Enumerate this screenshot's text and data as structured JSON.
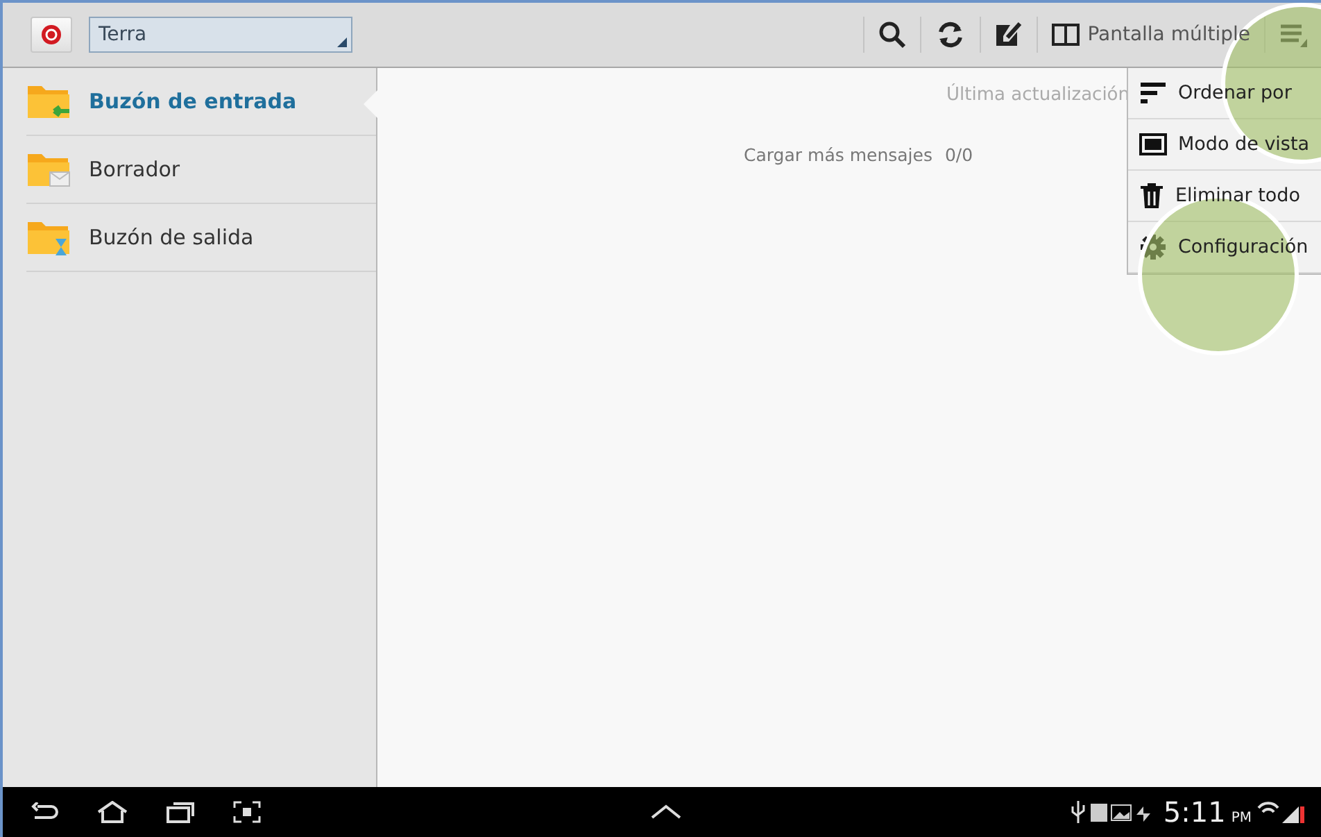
{
  "action_bar": {
    "account": "Terra",
    "actions": [
      {
        "kind": "search"
      },
      {
        "kind": "refresh"
      },
      {
        "kind": "compose"
      },
      {
        "kind": "split",
        "label": "Pantalla múltiple"
      },
      {
        "kind": "menu"
      }
    ]
  },
  "folders": [
    {
      "label": "Buzón de entrada",
      "kind": "inbox",
      "selected": true
    },
    {
      "label": "Borrador",
      "kind": "draft",
      "selected": false
    },
    {
      "label": "Buzón de salida",
      "kind": "outbox",
      "selected": false
    }
  ],
  "content": {
    "last_update": "Última actualización",
    "load_more": "Cargar más mensajes",
    "count": "0/0"
  },
  "menu": [
    {
      "label": "Ordenar por",
      "kind": "sort"
    },
    {
      "label": "Modo de vista",
      "kind": "view"
    },
    {
      "label": "Eliminar todo",
      "kind": "delete"
    },
    {
      "label": "Configuración",
      "kind": "settings"
    }
  ],
  "status_bar": {
    "time": "5:11",
    "ampm": "PM"
  }
}
